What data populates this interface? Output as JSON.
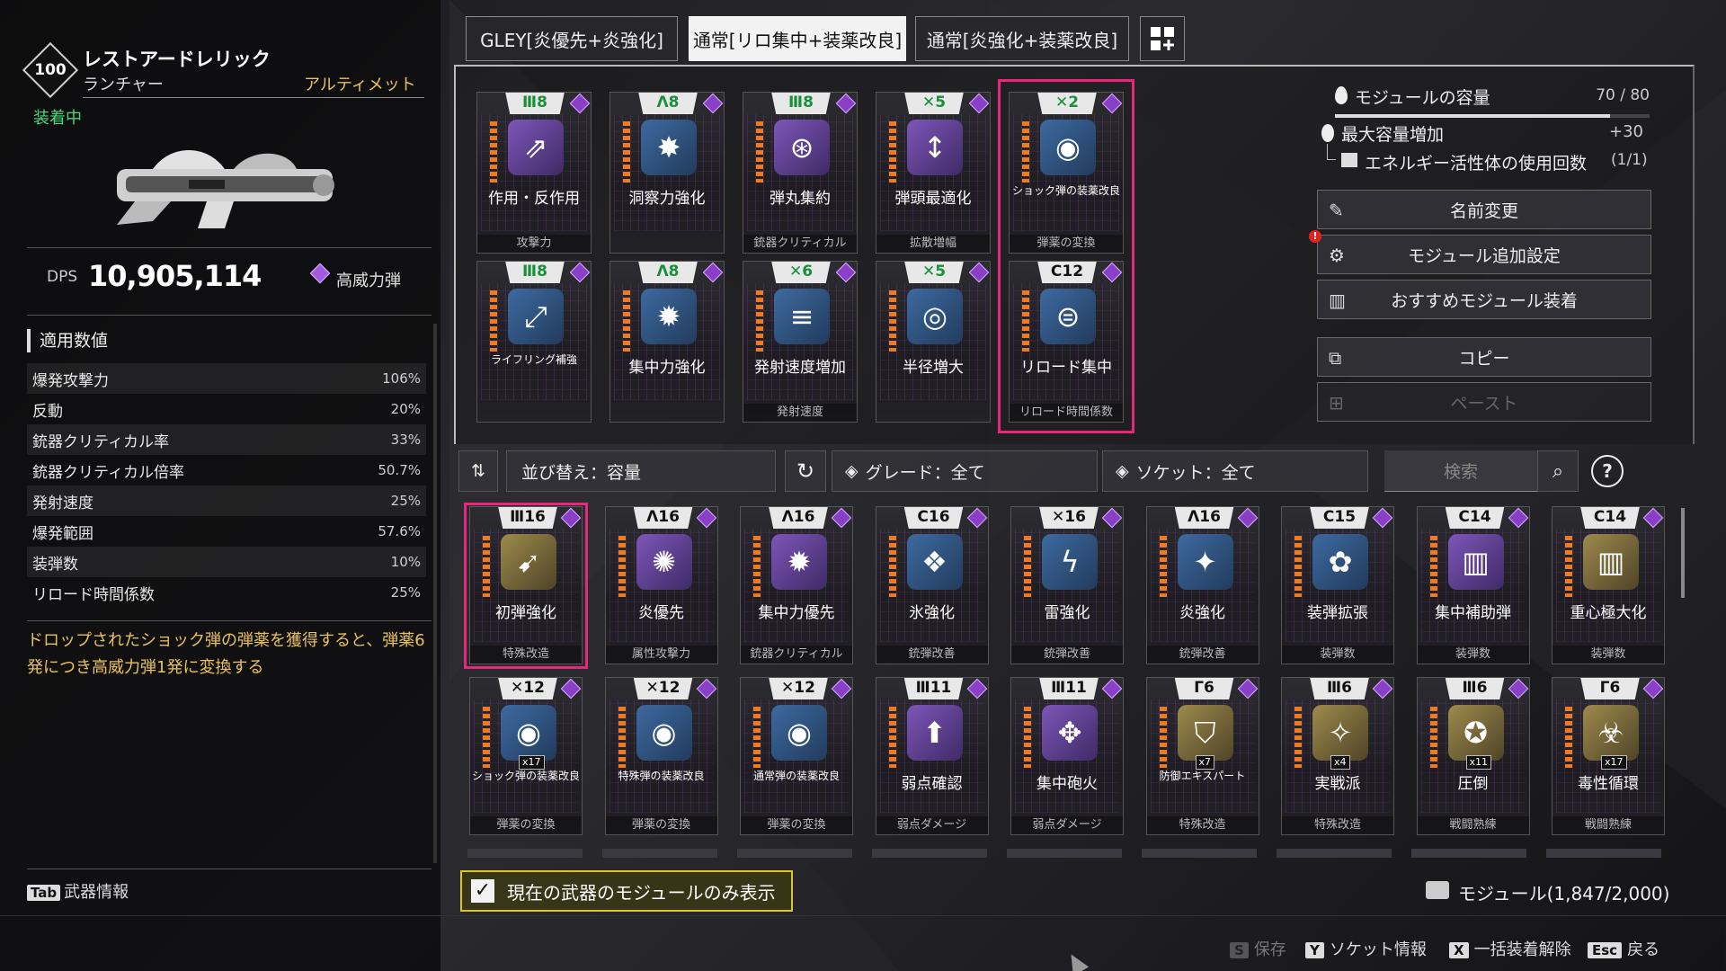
{
  "weapon": {
    "level": "100",
    "name": "レストアードレリック",
    "type": "ランチャー",
    "grade": "アルティメット",
    "equipped_label": "装着中",
    "dps_label": "DPS",
    "dps_value": "10,905,114",
    "ammo_type": "高威力弾"
  },
  "stats": {
    "header": "適用数値",
    "rows": [
      {
        "label": "爆発攻撃力",
        "value": "106%"
      },
      {
        "label": "反動",
        "value": "20%"
      },
      {
        "label": "銃器クリティカル率",
        "value": "33%"
      },
      {
        "label": "銃器クリティカル倍率",
        "value": "50.7%"
      },
      {
        "label": "発射速度",
        "value": "25%"
      },
      {
        "label": "爆発範囲",
        "value": "57.6%"
      },
      {
        "label": "装弾数",
        "value": "10%"
      },
      {
        "label": "リロード時間係数",
        "value": "25%"
      }
    ],
    "description": "ドロップされたショック弾の弾薬を獲得すると、弾薬6発につき高威力弾1発に変換する"
  },
  "tab_info": {
    "key": "Tab",
    "label": "武器情報"
  },
  "tabs": [
    {
      "label": "GLEY[炎優先+炎強化]"
    },
    {
      "label": "通常[リロ集中+装薬改良]"
    },
    {
      "label": "通常[炎強化+装薬改良]"
    }
  ],
  "equipped_modules": [
    {
      "badge": "Ⅲ8",
      "name": "作用・反作用",
      "category": "攻撃力",
      "icon": "⇗",
      "color": "purple"
    },
    {
      "badge": "Λ8",
      "name": "洞察力強化",
      "category": "",
      "icon": "✸",
      "color": "blue"
    },
    {
      "badge": "Ⅲ8",
      "name": "弾丸集約",
      "category": "銃器クリティカル",
      "icon": "⊛",
      "color": "purple"
    },
    {
      "badge": "✕5",
      "name": "弾頭最適化",
      "category": "拡散増幅",
      "icon": "↕",
      "color": "purple"
    },
    {
      "badge": "✕2",
      "name": "ショック弾の装薬改良",
      "category": "弾薬の変換",
      "icon": "◉",
      "color": "blue"
    },
    {
      "badge": "Ⅲ8",
      "name": "ライフリング補強",
      "category": "",
      "icon": "⤢",
      "color": "blue"
    },
    {
      "badge": "Λ8",
      "name": "集中力強化",
      "category": "",
      "icon": "✹",
      "color": "blue"
    },
    {
      "badge": "✕6",
      "name": "発射速度増加",
      "category": "発射速度",
      "icon": "≡",
      "color": "blue"
    },
    {
      "badge": "✕5",
      "name": "半径増大",
      "category": "",
      "icon": "◎",
      "color": "blue"
    },
    {
      "badge": "C12",
      "name": "リロード集中",
      "category": "リロード時間係数",
      "icon": "⊜",
      "color": "blue"
    }
  ],
  "capacity": {
    "label": "モジュールの容量",
    "value": "70 / 80",
    "fill_fraction": 0.875,
    "max_increase_label": "最大容量増加",
    "max_increase_value": "+30",
    "energy_label": "エネルギー活性体の使用回数",
    "energy_value": "(1/1)"
  },
  "actions": {
    "rename": "名前変更",
    "module_settings": "モジュール追加設定",
    "recommended": "おすすめモジュール装着",
    "copy": "コピー",
    "paste": "ペースト"
  },
  "filters": {
    "sort": "並び替え：容量",
    "grade": "グレード：全て",
    "socket": "ソケット：全て",
    "search_placeholder": "検索"
  },
  "inventory_modules": [
    {
      "badge": "Ⅲ16",
      "name": "初弾強化",
      "category": "特殊改造",
      "icon": "➹",
      "color": "gold"
    },
    {
      "badge": "Λ16",
      "name": "炎優先",
      "category": "属性攻撃力",
      "icon": "✺",
      "color": "purple"
    },
    {
      "badge": "Λ16",
      "name": "集中力優先",
      "category": "銃器クリティカル",
      "icon": "✹",
      "color": "purple"
    },
    {
      "badge": "C16",
      "name": "氷強化",
      "category": "銃弾改善",
      "icon": "❖",
      "color": "blue"
    },
    {
      "badge": "✕16",
      "name": "雷強化",
      "category": "銃弾改善",
      "icon": "ϟ",
      "color": "blue"
    },
    {
      "badge": "Λ16",
      "name": "炎強化",
      "category": "銃弾改善",
      "icon": "✦",
      "color": "blue"
    },
    {
      "badge": "C15",
      "name": "装弾拡張",
      "category": "装弾数",
      "icon": "✿",
      "color": "blue"
    },
    {
      "badge": "C14",
      "name": "集中補助弾",
      "category": "装弾数",
      "icon": "▥",
      "color": "purple"
    },
    {
      "badge": "C14",
      "name": "重心極大化",
      "category": "装弾数",
      "icon": "▥",
      "color": "gold"
    },
    {
      "badge": "✕12",
      "name": "ショック弾の装薬改良",
      "category": "弾薬の変換",
      "icon": "◉",
      "color": "blue",
      "count": "x17"
    },
    {
      "badge": "✕12",
      "name": "特殊弾の装薬改良",
      "category": "弾薬の変換",
      "icon": "◉",
      "color": "blue"
    },
    {
      "badge": "✕12",
      "name": "通常弾の装薬改良",
      "category": "弾薬の変換",
      "icon": "◉",
      "color": "blue"
    },
    {
      "badge": "Ⅲ11",
      "name": "弱点確認",
      "category": "弱点ダメージ",
      "icon": "⬆",
      "color": "purple"
    },
    {
      "badge": "Ⅲ11",
      "name": "集中砲火",
      "category": "弱点ダメージ",
      "icon": "✥",
      "color": "purple"
    },
    {
      "badge": "Γ6",
      "name": "防御エキスパート",
      "category": "特殊改造",
      "icon": "⛉",
      "color": "gold",
      "count": "x7"
    },
    {
      "badge": "Ⅲ6",
      "name": "実戦派",
      "category": "特殊改造",
      "icon": "✧",
      "color": "gold",
      "count": "x4"
    },
    {
      "badge": "Ⅲ6",
      "name": "圧倒",
      "category": "戦闘熟練",
      "icon": "✪",
      "color": "gold",
      "count": "x11"
    },
    {
      "badge": "Γ6",
      "name": "毒性循環",
      "category": "戦闘熟練",
      "icon": "☣",
      "color": "gold",
      "count": "x17"
    }
  ],
  "bottom": {
    "filter_checkbox": "現在の武器のモジュールのみ表示",
    "module_count": "モジュール(1,847/2,000)",
    "save": {
      "key": "S",
      "label": "保存"
    },
    "socket": {
      "key": "Y",
      "label": "ソケット情報"
    },
    "unequip": {
      "key": "X",
      "label": "一括装着解除"
    },
    "back": {
      "key": "Esc",
      "label": "戻る"
    }
  }
}
